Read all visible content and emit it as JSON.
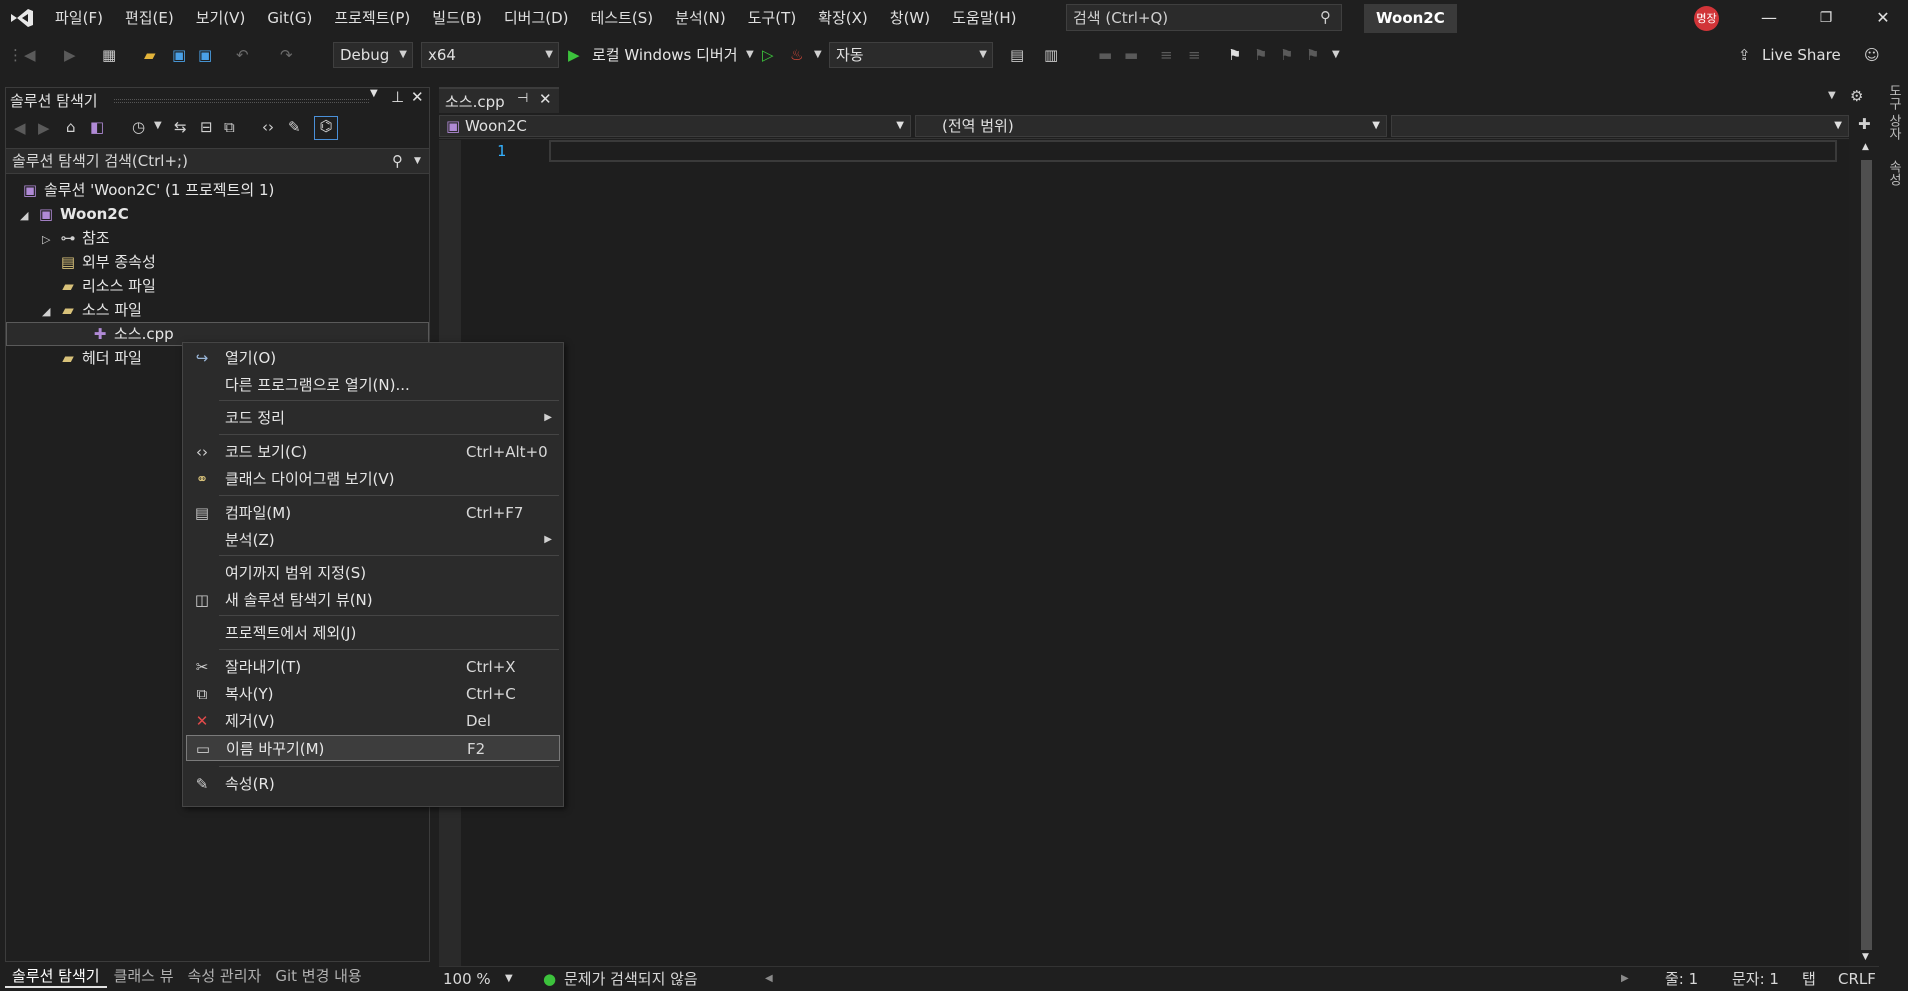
{
  "app": {
    "solution_title": "Woon2C",
    "avatar_text": "명장",
    "accent": "#d13438"
  },
  "menu": [
    "파일(F)",
    "편집(E)",
    "보기(V)",
    "Git(G)",
    "프로젝트(P)",
    "빌드(B)",
    "디버그(D)",
    "테스트(S)",
    "분석(N)",
    "도구(T)",
    "확장(X)",
    "창(W)",
    "도움말(H)"
  ],
  "search": {
    "placeholder": "검색 (Ctrl+Q)"
  },
  "toolbar": {
    "config": "Debug",
    "platform": "x64",
    "debugger": "로컬 Windows 디버거",
    "auto": "자동",
    "live_share": "Live Share"
  },
  "solution_explorer": {
    "title": "솔루션 탐색기",
    "search_placeholder": "솔루션 탐색기 검색(Ctrl+;)",
    "tree": {
      "solution": "솔루션 'Woon2C' (1 프로젝트의 1)",
      "project": "Woon2C",
      "references": "참조",
      "external": "외부 종속성",
      "resources": "리소스 파일",
      "sources": "소스 파일",
      "source_cpp": "소스.cpp",
      "headers": "헤더 파일"
    },
    "tabs": [
      "솔루션 탐색기",
      "클래스 뷰",
      "속성 관리자",
      "Git 변경 내용"
    ]
  },
  "editor": {
    "tab": "소스.cpp",
    "nav_project": "Woon2C",
    "nav_scope": "(전역 범위)",
    "line_number": "1"
  },
  "status": {
    "zoom": "100 %",
    "issues": "문제가 검색되지 않음",
    "line": "줄: 1",
    "char": "문자: 1",
    "tab": "탭",
    "eol": "CRLF"
  },
  "right_tabs": [
    "도구 상자",
    "속성"
  ],
  "context_menu": {
    "open": "열기(O)",
    "open_with": "다른 프로그램으로 열기(N)...",
    "code_cleanup": "코드 정리",
    "view_code": "코드 보기(C)",
    "view_code_sc": "Ctrl+Alt+0",
    "class_diagram": "클래스 다이어그램 보기(V)",
    "compile": "컴파일(M)",
    "compile_sc": "Ctrl+F7",
    "analyze": "분석(Z)",
    "scope_to_this": "여기까지 범위 지정(S)",
    "new_se_view": "새 솔루션 탐색기 뷰(N)",
    "exclude": "프로젝트에서 제외(J)",
    "cut": "잘라내기(T)",
    "cut_sc": "Ctrl+X",
    "copy": "복사(Y)",
    "copy_sc": "Ctrl+C",
    "remove": "제거(V)",
    "remove_sc": "Del",
    "rename": "이름 바꾸기(M)",
    "rename_sc": "F2",
    "properties": "속성(R)"
  }
}
